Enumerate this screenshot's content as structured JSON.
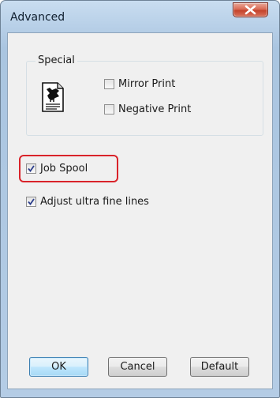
{
  "window": {
    "title": "Advanced",
    "close_icon": "close-x-icon"
  },
  "special_group": {
    "label": "Special",
    "icon": "document-page-icon",
    "mirror_print": {
      "label": "Mirror Print",
      "checked": false
    },
    "negative_print": {
      "label": "Negative Print",
      "checked": false
    }
  },
  "options": {
    "job_spool": {
      "label": "Job Spool",
      "checked": true
    },
    "adjust_fine_lines": {
      "label": "Adjust ultra fine lines",
      "checked": true
    }
  },
  "buttons": {
    "ok": "OK",
    "cancel": "Cancel",
    "default": "Default"
  },
  "colors": {
    "highlight_border": "#d9232a",
    "close_button": "#c4432b",
    "default_button_border": "#3c7fb1"
  }
}
